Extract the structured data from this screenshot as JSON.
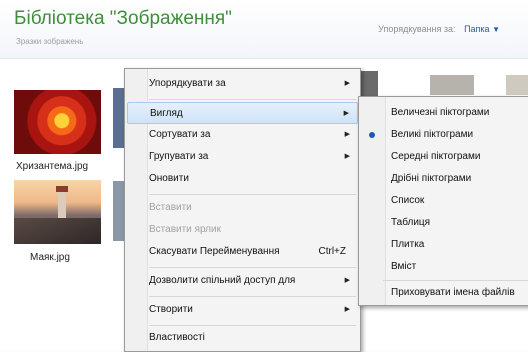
{
  "header": {
    "title": "Бібліотека \"Зображення\"",
    "subtitle": "Зразки зображень",
    "arrange_label": "Упорядкування за:",
    "arrange_value": "Папка"
  },
  "files": [
    {
      "name": "Хризантема.jpg"
    },
    {
      "name": "Маяк.jpg"
    }
  ],
  "context_menu": {
    "items": [
      {
        "label": "Упорядкувати за",
        "submenu": true
      },
      {
        "label": "Вигляд",
        "submenu": true,
        "highlighted": true
      },
      {
        "label": "Сортувати за",
        "submenu": true
      },
      {
        "label": "Групувати за",
        "submenu": true
      },
      {
        "label": "Оновити"
      },
      {
        "label": "Вставити",
        "disabled": true
      },
      {
        "label": "Вставити ярлик",
        "disabled": true
      },
      {
        "label": "Скасувати Перейменування",
        "shortcut": "Ctrl+Z"
      },
      {
        "label": "Дозволити спільний доступ для",
        "submenu": true
      },
      {
        "label": "Створити",
        "submenu": true
      },
      {
        "label": "Властивості"
      }
    ]
  },
  "view_submenu": {
    "items": [
      {
        "label": "Величезні піктограми"
      },
      {
        "label": "Великі піктограми",
        "selected": true
      },
      {
        "label": "Середні піктограми"
      },
      {
        "label": "Дрібні піктограми"
      },
      {
        "label": "Список"
      },
      {
        "label": "Таблиця"
      },
      {
        "label": "Плитка"
      },
      {
        "label": "Вміст"
      },
      {
        "label": "Приховувати імена файлів"
      }
    ]
  },
  "colors": {
    "title_green": "#3f8f3a",
    "accent_blue": "#1f5fa8",
    "menu_highlight": "#cfe3f8"
  }
}
